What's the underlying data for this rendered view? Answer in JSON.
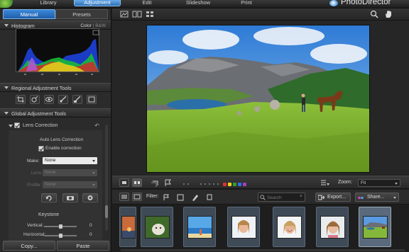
{
  "module_tabs": [
    "Library",
    "Adjustment",
    "Edit",
    "Slideshow",
    "Print"
  ],
  "brand": "PhotoDirector",
  "panel_tabs": [
    "Manual",
    "Presets"
  ],
  "histogram": {
    "title": "Histogram",
    "mode_label": "Color",
    "mode_alt": "B&W"
  },
  "regional_title": "Regional Adjustment Tools",
  "global_title": "Global Adjustment Tools",
  "lens": {
    "title": "Lens Correction",
    "subtitle": "Auto Lens Correction",
    "enable_label": "Enable correction",
    "make_label": "Make:",
    "make_value": "None",
    "lens_label": "Lens:",
    "lens_value": "None",
    "profile_label": "Profile:",
    "profile_value": "None",
    "keystone_title": "Keystone",
    "vertical_label": "Vertical:",
    "vertical_value": "0",
    "horizontal_label": "Horizontal:",
    "horizontal_value": "0"
  },
  "buttons": {
    "copy": "Copy...",
    "paste": "Paste"
  },
  "view_toolbar": {
    "zoom_label": "Zoom:",
    "zoom_value": "Fit",
    "colors": [
      "#e03030",
      "#f0d020",
      "#30a030",
      "#3070e0",
      "#a040c0"
    ]
  },
  "filter_bar": {
    "filter_label": "Filter:",
    "search_placeholder": "Search",
    "export_label": "Export...",
    "share_label": "Share..."
  },
  "thumbnails": [
    "sunset",
    "cat",
    "beach",
    "woman",
    "woman-laughing",
    "woman-portrait",
    "landscape-horse"
  ],
  "active_thumbnail": "landscape-horse"
}
